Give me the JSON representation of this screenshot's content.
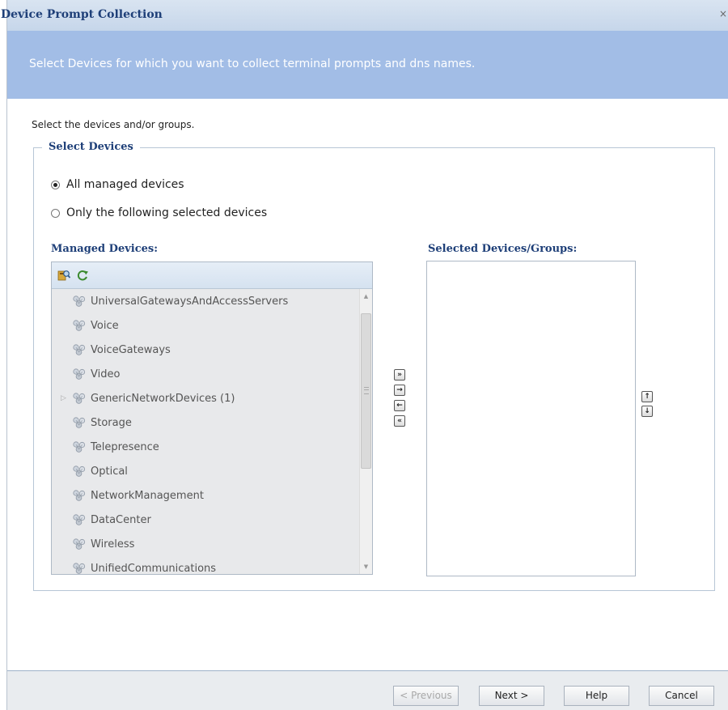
{
  "dialog": {
    "title": "Device Prompt Collection",
    "close_label": "×",
    "banner_text": "Select Devices for which you want to collect terminal prompts and dns names.",
    "instruction": "Select the devices and/or groups."
  },
  "select_devices": {
    "legend": "Select Devices",
    "radio_all": "All managed devices",
    "radio_all_checked": true,
    "radio_selected": "Only the following selected devices",
    "radio_selected_checked": false
  },
  "managed_devices": {
    "label": "Managed Devices:",
    "toolbar_icons": [
      "find-device-icon",
      "refresh-icon"
    ],
    "items": [
      {
        "label": "UniversalGatewaysAndAccessServers",
        "expandable": false
      },
      {
        "label": "Voice",
        "expandable": false
      },
      {
        "label": "VoiceGateways",
        "expandable": false
      },
      {
        "label": "Video",
        "expandable": false
      },
      {
        "label": "GenericNetworkDevices (1)",
        "expandable": true
      },
      {
        "label": "Storage",
        "expandable": false
      },
      {
        "label": "Telepresence",
        "expandable": false
      },
      {
        "label": "Optical",
        "expandable": false
      },
      {
        "label": "NetworkManagement",
        "expandable": false
      },
      {
        "label": "DataCenter",
        "expandable": false
      },
      {
        "label": "Wireless",
        "expandable": false
      },
      {
        "label": "UnifiedCommunications",
        "expandable": false
      }
    ]
  },
  "selected_devices": {
    "label": "Selected Devices/Groups:",
    "items": []
  },
  "transfer_buttons": {
    "add_all": "»",
    "add": "→",
    "remove": "←",
    "remove_all": "«",
    "move_up": "↑",
    "move_down": "↓"
  },
  "footer": {
    "previous": "< Previous",
    "next": "Next >",
    "help": "Help",
    "cancel": "Cancel"
  },
  "colors": {
    "title": "#1e3f78",
    "banner": "#a2bde6",
    "dialog_bg": "#e9ecef"
  }
}
